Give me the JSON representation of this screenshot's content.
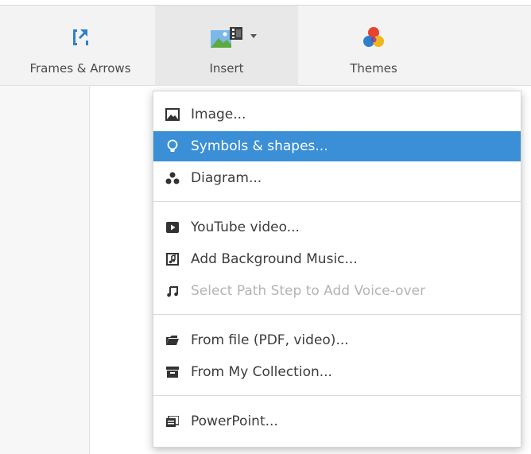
{
  "toolbar": {
    "frames_label": "Frames & Arrows",
    "insert_label": "Insert",
    "themes_label": "Themes"
  },
  "menu": {
    "items": [
      {
        "label": "Image...",
        "icon": "image-icon"
      },
      {
        "label": "Symbols & shapes...",
        "icon": "lightbulb-icon",
        "state": "highlighted"
      },
      {
        "label": "Diagram...",
        "icon": "diagram-icon"
      },
      {
        "label": "YouTube video...",
        "icon": "youtube-icon"
      },
      {
        "label": "Add Background Music...",
        "icon": "music-file-icon"
      },
      {
        "label": "Select Path Step to Add Voice-over",
        "icon": "music-note-icon",
        "state": "disabled"
      },
      {
        "label": "From file (PDF, video)...",
        "icon": "folder-icon"
      },
      {
        "label": "From My Collection...",
        "icon": "collection-icon"
      },
      {
        "label": "PowerPoint...",
        "icon": "powerpoint-icon"
      }
    ]
  },
  "colors": {
    "highlight": "#3a8fd6",
    "toolbar_bg": "#f3f3f3",
    "accent_blue": "#2f7fcf"
  }
}
